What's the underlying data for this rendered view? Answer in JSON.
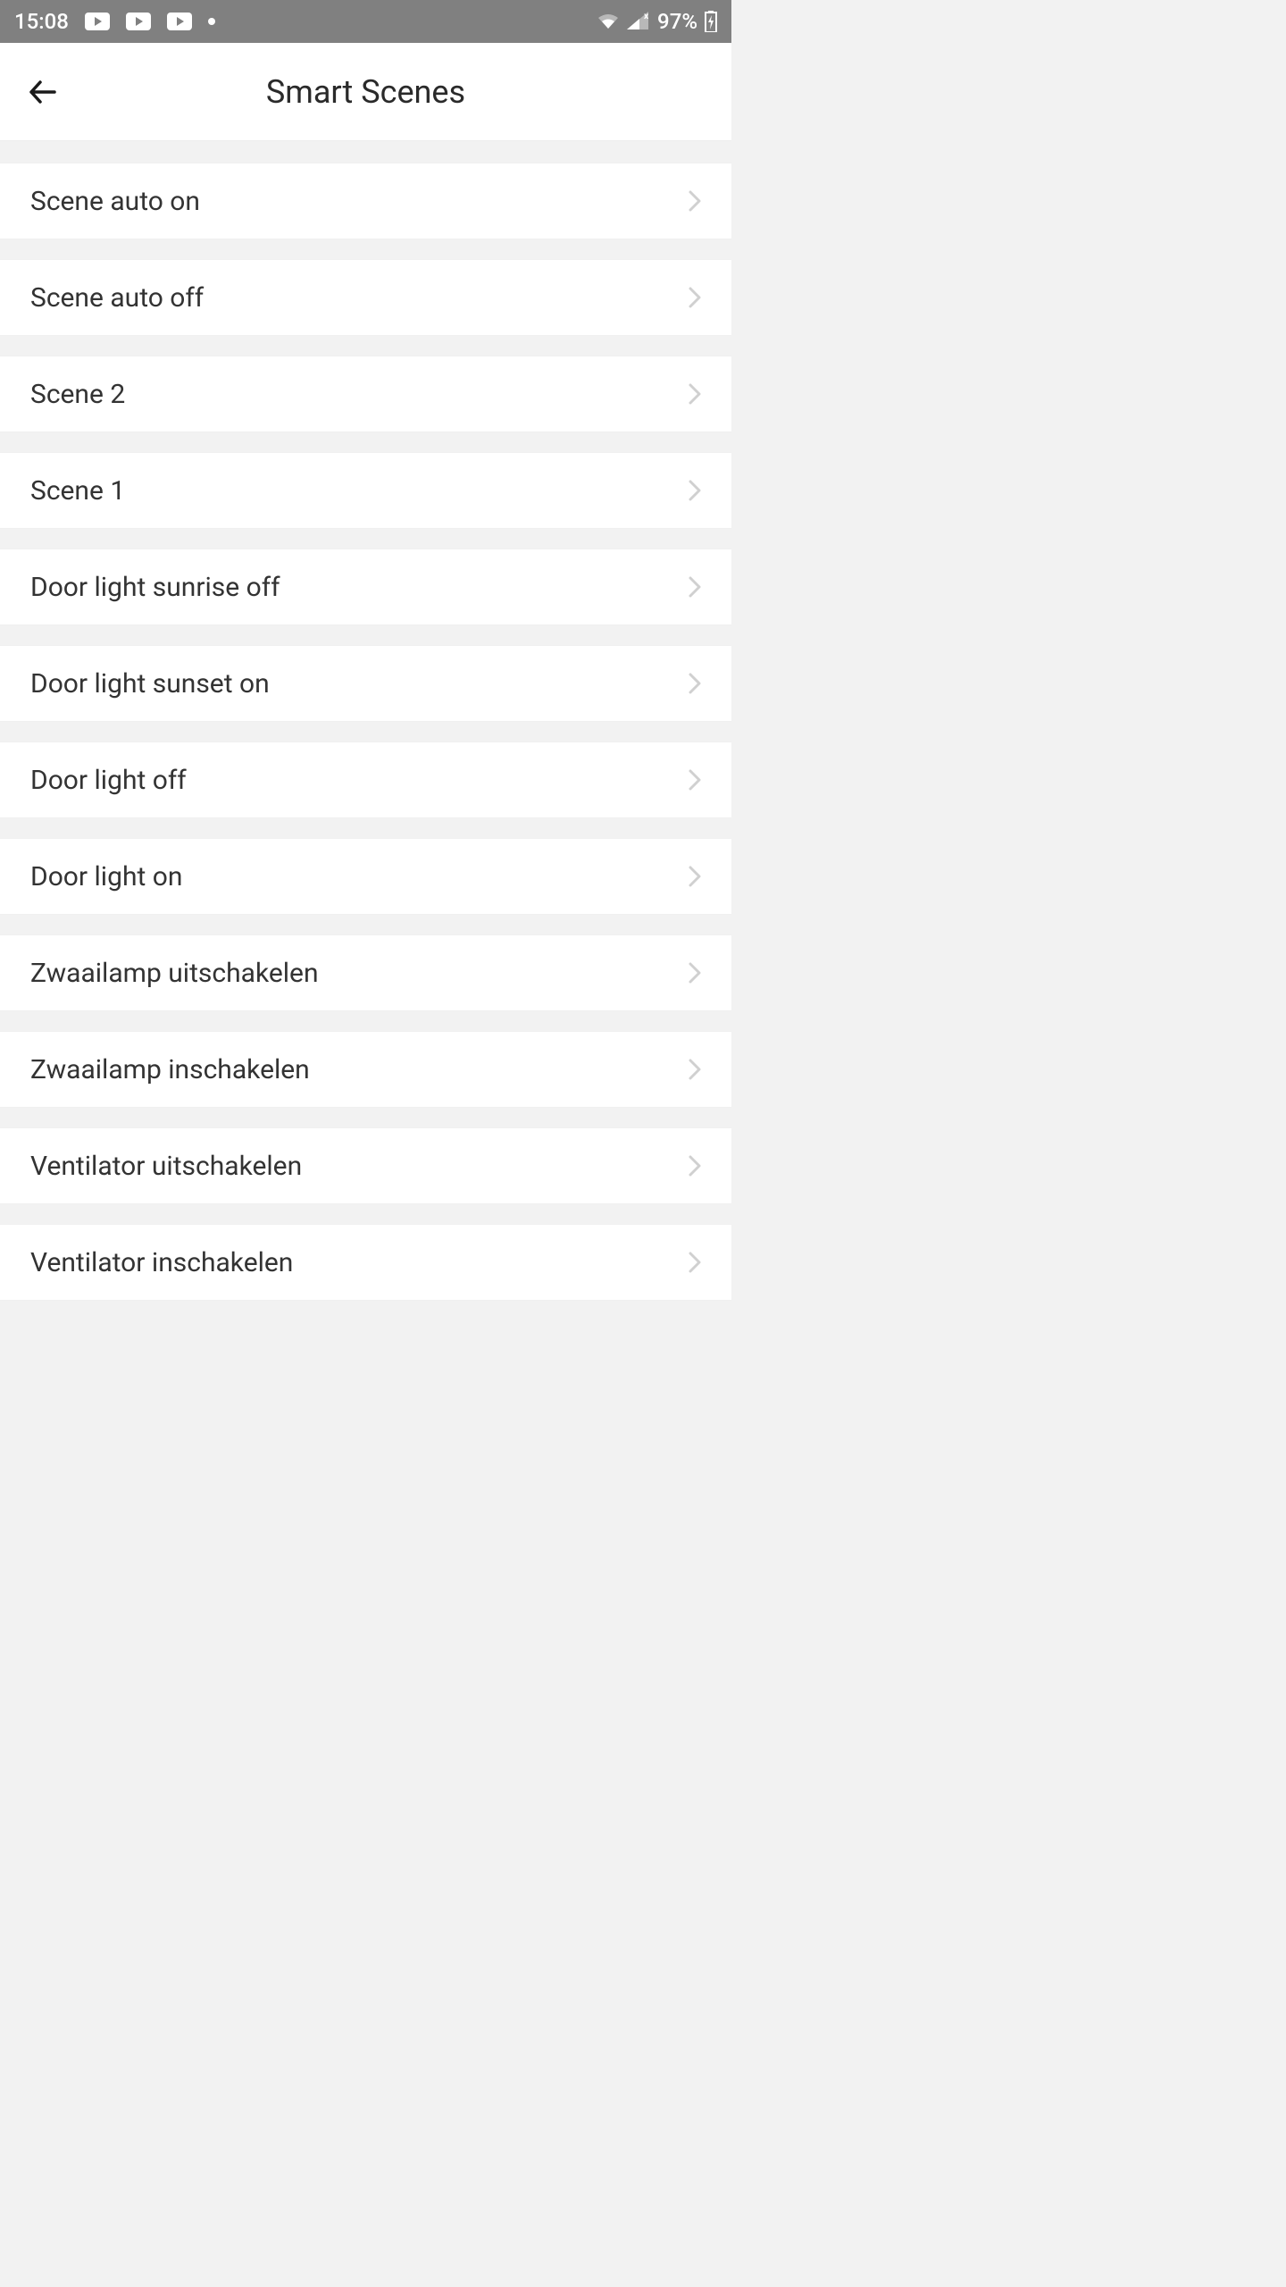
{
  "status_bar": {
    "time": "15:08",
    "battery_percent": "97%"
  },
  "header": {
    "title": "Smart Scenes"
  },
  "scenes": [
    {
      "label": "Scene auto on"
    },
    {
      "label": "Scene auto off"
    },
    {
      "label": "Scene 2"
    },
    {
      "label": "Scene 1"
    },
    {
      "label": "Door light sunrise off"
    },
    {
      "label": "Door light sunset on"
    },
    {
      "label": "Door light off"
    },
    {
      "label": "Door light on"
    },
    {
      "label": "Zwaailamp uitschakelen"
    },
    {
      "label": "Zwaailamp inschakelen"
    },
    {
      "label": "Ventilator uitschakelen"
    },
    {
      "label": "Ventilator inschakelen"
    }
  ]
}
